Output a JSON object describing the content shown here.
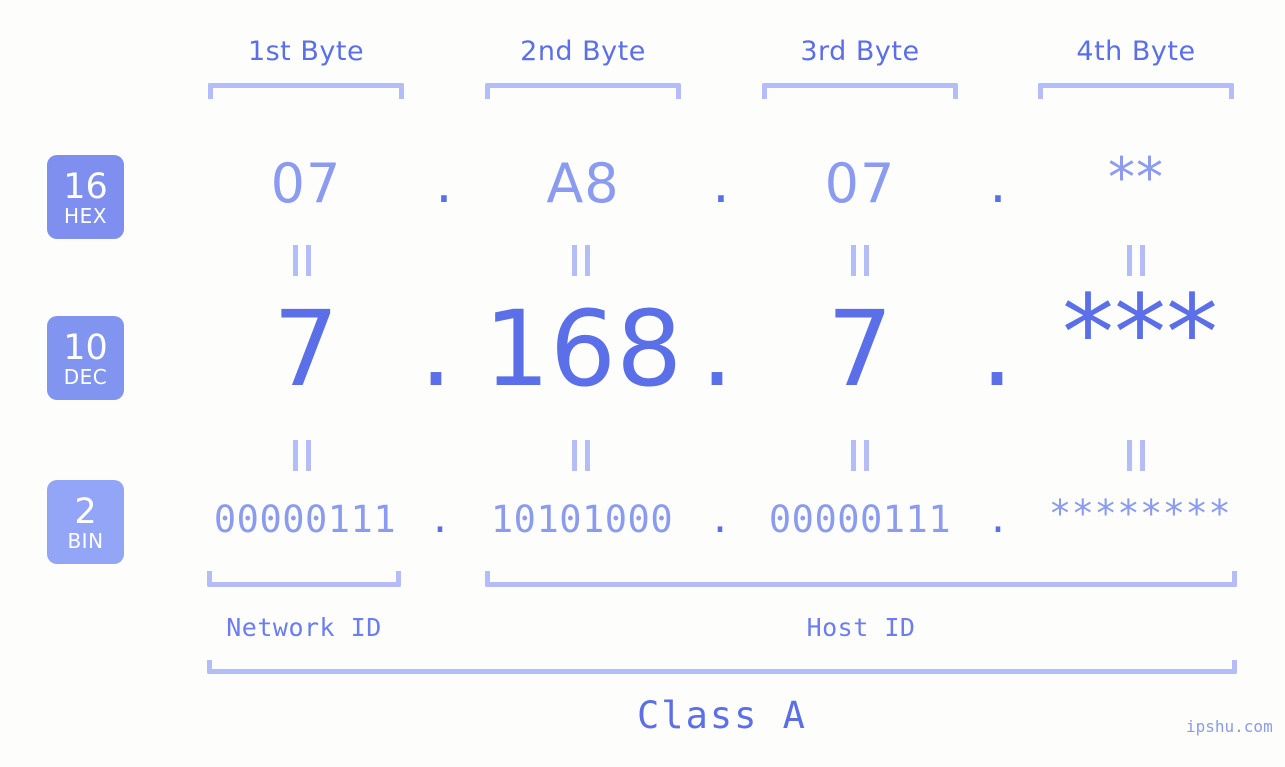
{
  "background_color": "#fdfefb",
  "accent_color": "#5a6fe8",
  "accent_light_color": "#8b9bf0",
  "bracket_color": "#b5bdf9",
  "header": {
    "byte_labels": [
      {
        "label": "1st Byte"
      },
      {
        "label": "2nd Byte"
      },
      {
        "label": "3rd Byte"
      },
      {
        "label": "4th Byte"
      }
    ]
  },
  "rows": [
    {
      "base_number": "16",
      "base_name": "HEX",
      "badge_color": "#7e8ff0",
      "octets": [
        "07",
        "A8",
        "07",
        "**"
      ],
      "separators": [
        ".",
        ".",
        "."
      ]
    },
    {
      "base_number": "10",
      "base_name": "DEC",
      "badge_color": "#8094f0",
      "octets": [
        "7",
        "168",
        "7",
        "***"
      ],
      "separators": [
        ".",
        ".",
        "."
      ]
    },
    {
      "base_number": "2",
      "base_name": "BIN",
      "badge_color": "#93a5f7",
      "octets": [
        "00000111",
        "10101000",
        "00000111",
        "********"
      ],
      "separators": [
        ".",
        ".",
        "."
      ]
    }
  ],
  "equivalence_mark": "=",
  "footer": {
    "network_id_label": "Network ID",
    "host_id_label": "Host ID",
    "class_label": "Class A",
    "watermark": "ipshu.com"
  }
}
